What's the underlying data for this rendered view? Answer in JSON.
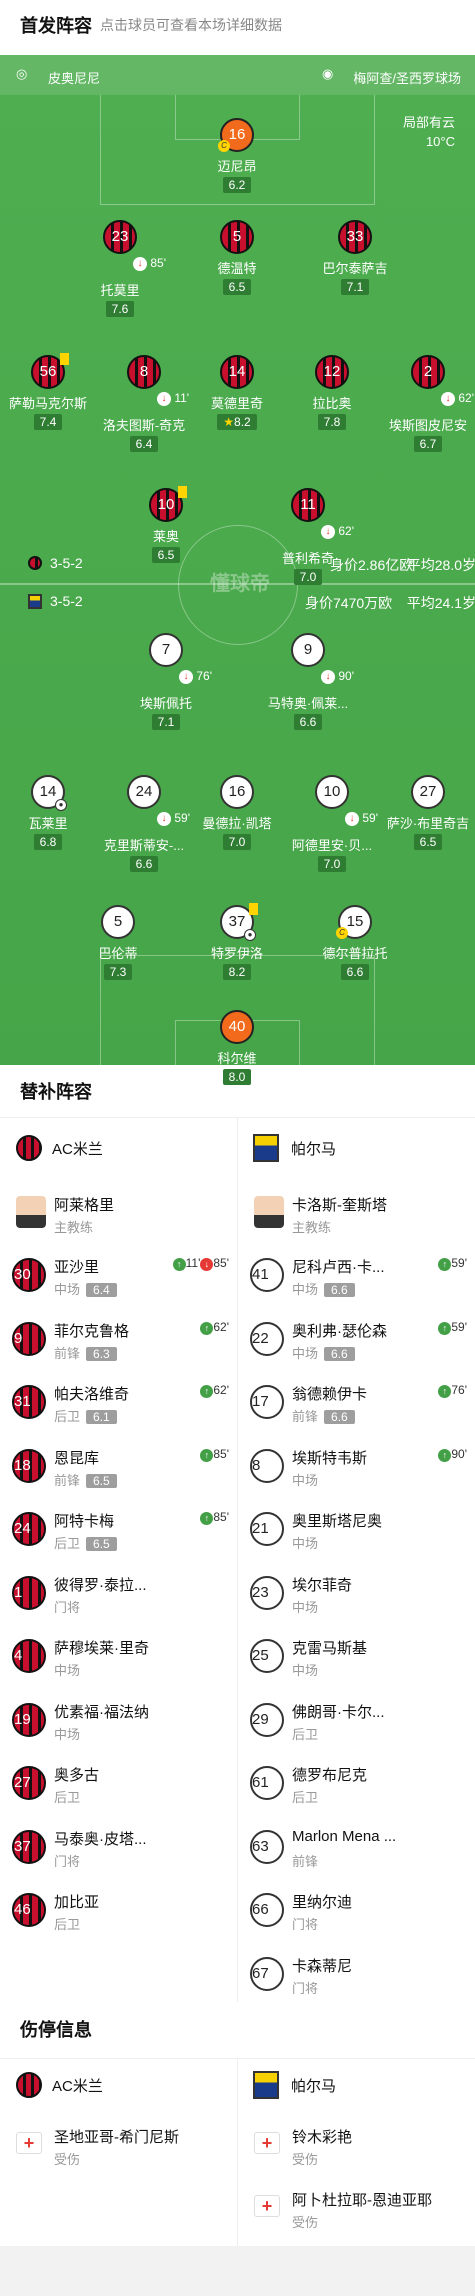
{
  "header": {
    "title": "首发阵容",
    "subtitle": "点击球员可查看本场详细数据"
  },
  "pitch": {
    "coach_home": "皮奥尼尼",
    "venue": "梅阿查/圣西罗球场",
    "weather": "局部有云",
    "temp": "10°C",
    "watermark": "懂球帝",
    "home_formation": "3-5-2",
    "home_value": "身价2.86亿欧",
    "home_age": "平均28.0岁",
    "away_formation": "3-5-2",
    "away_value": "身价7470万欧",
    "away_age": "平均24.1岁"
  },
  "players": [
    {
      "n": "16",
      "name": "迈尼昂",
      "r": "6.2",
      "t": "g",
      "cap": true
    },
    {
      "n": "23",
      "name": "托莫里",
      "r": "7.6",
      "t": "m",
      "ev": "85'"
    },
    {
      "n": "5",
      "name": "德温特",
      "r": "6.5",
      "t": "m"
    },
    {
      "n": "33",
      "name": "巴尔泰萨吉",
      "r": "7.1",
      "t": "m"
    },
    {
      "n": "56",
      "name": "萨勒马克尔斯",
      "r": "7.4",
      "t": "m",
      "yc": true
    },
    {
      "n": "8",
      "name": "洛夫图斯-奇克",
      "r": "6.4",
      "t": "m",
      "ev": "11'"
    },
    {
      "n": "14",
      "name": "莫德里奇",
      "r": "8.2",
      "t": "m",
      "star": true
    },
    {
      "n": "12",
      "name": "拉比奥",
      "r": "7.8",
      "t": "m"
    },
    {
      "n": "2",
      "name": "埃斯图皮尼安",
      "r": "6.7",
      "t": "m",
      "ev": "62'"
    },
    {
      "n": "10",
      "name": "莱奥",
      "r": "6.5",
      "t": "m",
      "yc": true
    },
    {
      "n": "11",
      "name": "普利希奇",
      "r": "7.0",
      "t": "m",
      "ev": "62'"
    },
    {
      "n": "7",
      "name": "埃斯佩托",
      "r": "7.1",
      "t": "p",
      "ev": "76'"
    },
    {
      "n": "9",
      "name": "马特奥·佩莱...",
      "r": "6.6",
      "t": "p",
      "ev": "90'"
    },
    {
      "n": "14",
      "name": "瓦莱里",
      "r": "6.8",
      "t": "p",
      "ball": true
    },
    {
      "n": "24",
      "name": "克里斯蒂安-...",
      "r": "6.6",
      "t": "p",
      "ev": "59'"
    },
    {
      "n": "16",
      "name": "曼德拉·凯塔",
      "r": "7.0",
      "t": "p"
    },
    {
      "n": "10",
      "name": "阿德里安·贝...",
      "r": "7.0",
      "t": "p",
      "ev": "59'"
    },
    {
      "n": "27",
      "name": "萨沙·布里奇吉",
      "r": "6.5",
      "t": "p"
    },
    {
      "n": "5",
      "name": "巴伦蒂",
      "r": "7.3",
      "t": "p"
    },
    {
      "n": "37",
      "name": "特罗伊洛",
      "r": "8.2",
      "t": "p",
      "yc": true,
      "ball": true
    },
    {
      "n": "15",
      "name": "德尔普拉托",
      "r": "6.6",
      "t": "p",
      "cap": true
    },
    {
      "n": "40",
      "name": "科尔维",
      "r": "8.0",
      "t": "g"
    }
  ],
  "subs": {
    "title": "替补阵容",
    "home_team": "AC米兰",
    "away_team": "帕尔马",
    "home_coach": {
      "name": "阿莱格里",
      "role": "主教练"
    },
    "away_coach": {
      "name": "卡洛斯-奎斯塔",
      "role": "主教练"
    },
    "home": [
      {
        "n": "30",
        "name": "亚沙里",
        "pos": "中场",
        "r": "6.4",
        "ev": "11'",
        "ev2": "85'"
      },
      {
        "n": "9",
        "name": "菲尔克鲁格",
        "pos": "前锋",
        "r": "6.3",
        "ev": "62'"
      },
      {
        "n": "31",
        "name": "帕夫洛维奇",
        "pos": "后卫",
        "r": "6.1",
        "ev": "62'"
      },
      {
        "n": "18",
        "name": "恩昆库",
        "pos": "前锋",
        "r": "6.5",
        "ev": "85'"
      },
      {
        "n": "24",
        "name": "阿特卡梅",
        "pos": "后卫",
        "r": "6.5",
        "ev": "85'"
      },
      {
        "n": "1",
        "name": "彼得罗·泰拉...",
        "pos": "门将"
      },
      {
        "n": "4",
        "name": "萨穆埃莱·里奇",
        "pos": "中场"
      },
      {
        "n": "19",
        "name": "优素福·福法纳",
        "pos": "中场"
      },
      {
        "n": "27",
        "name": "奥多古",
        "pos": "后卫"
      },
      {
        "n": "37",
        "name": "马泰奥·皮塔...",
        "pos": "门将"
      },
      {
        "n": "46",
        "name": "加比亚",
        "pos": "后卫"
      }
    ],
    "away": [
      {
        "n": "41",
        "name": "尼科卢西·卡...",
        "pos": "中场",
        "r": "6.6",
        "ev": "59'"
      },
      {
        "n": "22",
        "name": "奥利弗·瑟伦森",
        "pos": "中场",
        "r": "6.6",
        "ev": "59'"
      },
      {
        "n": "17",
        "name": "翁德赖伊卡",
        "pos": "前锋",
        "r": "6.6",
        "ev": "76'"
      },
      {
        "n": "8",
        "name": "埃斯特韦斯",
        "pos": "中场",
        "ev": "90'"
      },
      {
        "n": "21",
        "name": "奥里斯塔尼奥",
        "pos": "中场"
      },
      {
        "n": "23",
        "name": "埃尔菲奇",
        "pos": "中场"
      },
      {
        "n": "25",
        "name": "克雷马斯基",
        "pos": "中场"
      },
      {
        "n": "29",
        "name": "佛朗哥·卡尔...",
        "pos": "后卫"
      },
      {
        "n": "61",
        "name": "德罗布尼克",
        "pos": "后卫"
      },
      {
        "n": "63",
        "name": "Marlon Mena ...",
        "pos": "前锋"
      },
      {
        "n": "66",
        "name": "里纳尔迪",
        "pos": "门将"
      },
      {
        "n": "67",
        "name": "卡森蒂尼",
        "pos": "门将"
      }
    ]
  },
  "injury": {
    "title": "伤停信息",
    "home_team": "AC米兰",
    "away_team": "帕尔马",
    "home": [
      {
        "name": "圣地亚哥-希门尼斯",
        "status": "受伤"
      }
    ],
    "away": [
      {
        "name": "铃木彩艳",
        "status": "受伤"
      },
      {
        "name": "阿卜杜拉耶-恩迪亚耶",
        "status": "受伤"
      }
    ]
  }
}
